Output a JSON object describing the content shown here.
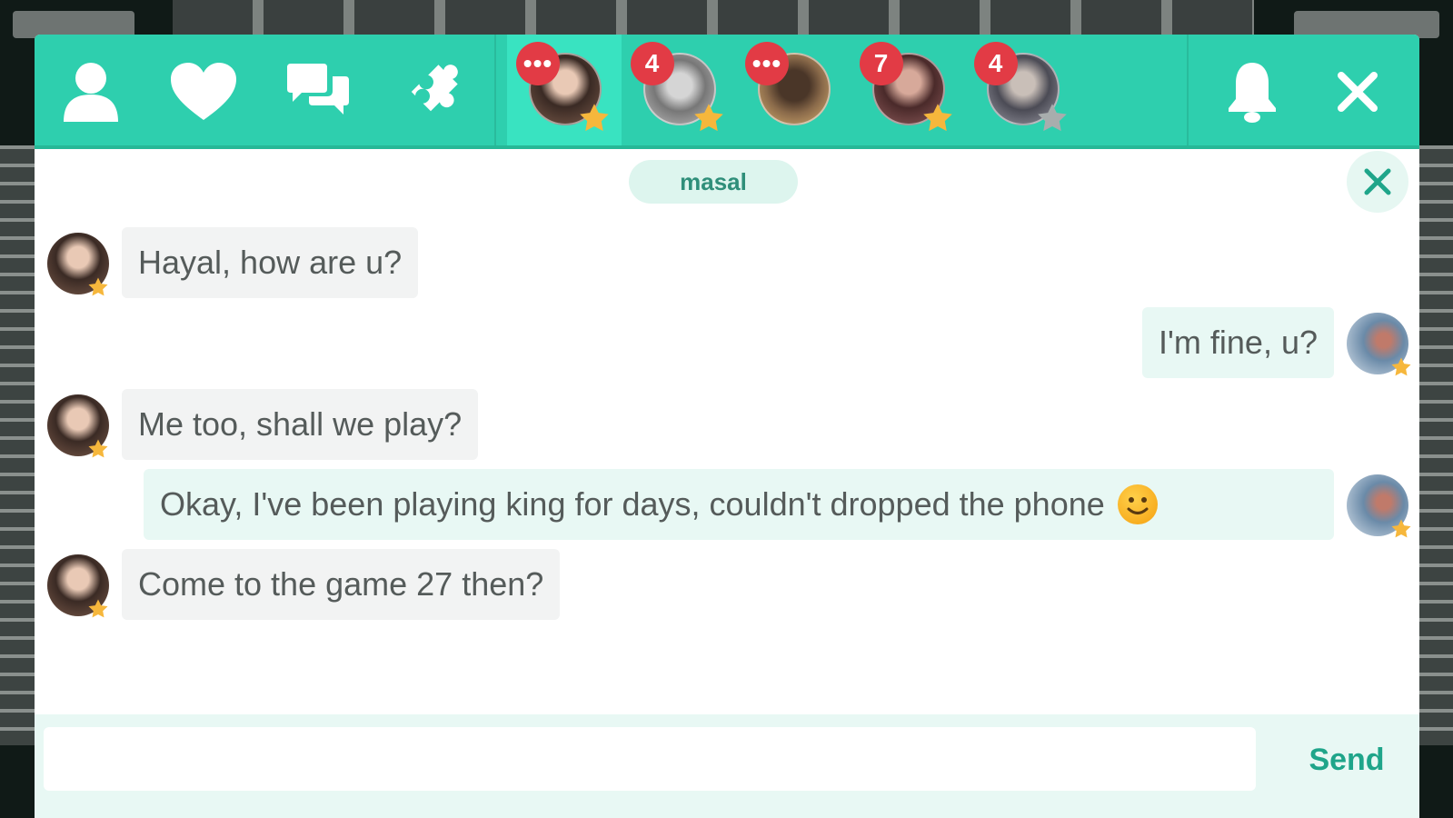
{
  "header": {
    "nav_icons": [
      {
        "name": "profile-icon"
      },
      {
        "name": "heart-icon"
      },
      {
        "name": "chat-bubbles-icon"
      },
      {
        "name": "puzzle-icon"
      }
    ],
    "contacts": [
      {
        "badge": "•••",
        "active": true,
        "star": "gold"
      },
      {
        "badge": "4",
        "active": false,
        "star": "gold"
      },
      {
        "badge": "•••",
        "active": false,
        "star": "none"
      },
      {
        "badge": "7",
        "active": false,
        "star": "gold"
      },
      {
        "badge": "4",
        "active": false,
        "star": "gray"
      }
    ],
    "notification_icon": "bell-icon",
    "close_icon": "close-icon"
  },
  "conversation": {
    "contact_name": "masal",
    "messages": [
      {
        "from": "them",
        "text": "Hayal, how are u?"
      },
      {
        "from": "me",
        "text": "I'm fine, u?"
      },
      {
        "from": "them",
        "text": "Me too, shall we play?"
      },
      {
        "from": "me",
        "text": "Okay, I've been playing king for days, couldn't dropped the phone",
        "emoji": "smiley"
      },
      {
        "from": "them",
        "text": "Come to the game 27 then?"
      }
    ]
  },
  "composer": {
    "placeholder": "",
    "value": "",
    "send_label": "Send"
  },
  "colors": {
    "header": "#2ecfae",
    "active_tab": "#39e3c1",
    "badge": "#e23b45",
    "star_gold": "#f6b73c",
    "star_gray": "#a8adad",
    "accent_text": "#1fa58a"
  }
}
